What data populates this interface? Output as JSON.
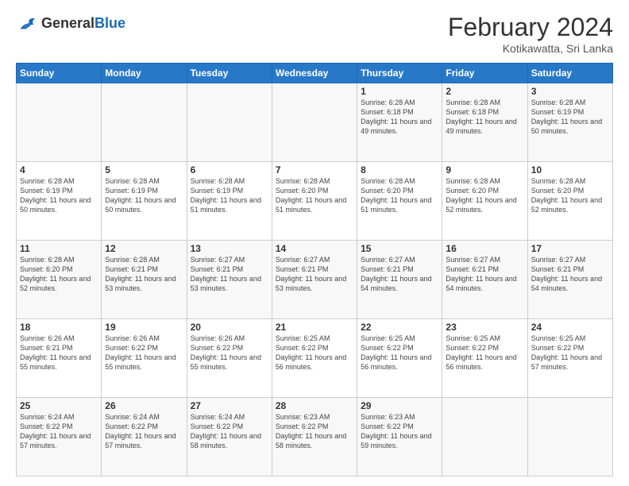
{
  "header": {
    "logo_general": "General",
    "logo_blue": "Blue",
    "title": "February 2024",
    "location": "Kotikawatta, Sri Lanka"
  },
  "weekdays": [
    "Sunday",
    "Monday",
    "Tuesday",
    "Wednesday",
    "Thursday",
    "Friday",
    "Saturday"
  ],
  "weeks": [
    [
      {
        "day": "",
        "info": ""
      },
      {
        "day": "",
        "info": ""
      },
      {
        "day": "",
        "info": ""
      },
      {
        "day": "",
        "info": ""
      },
      {
        "day": "1",
        "info": "Sunrise: 6:28 AM\nSunset: 6:18 PM\nDaylight: 11 hours and 49 minutes."
      },
      {
        "day": "2",
        "info": "Sunrise: 6:28 AM\nSunset: 6:18 PM\nDaylight: 11 hours and 49 minutes."
      },
      {
        "day": "3",
        "info": "Sunrise: 6:28 AM\nSunset: 6:19 PM\nDaylight: 11 hours and 50 minutes."
      }
    ],
    [
      {
        "day": "4",
        "info": "Sunrise: 6:28 AM\nSunset: 6:19 PM\nDaylight: 11 hours and 50 minutes."
      },
      {
        "day": "5",
        "info": "Sunrise: 6:28 AM\nSunset: 6:19 PM\nDaylight: 11 hours and 50 minutes."
      },
      {
        "day": "6",
        "info": "Sunrise: 6:28 AM\nSunset: 6:19 PM\nDaylight: 11 hours and 51 minutes."
      },
      {
        "day": "7",
        "info": "Sunrise: 6:28 AM\nSunset: 6:20 PM\nDaylight: 11 hours and 51 minutes."
      },
      {
        "day": "8",
        "info": "Sunrise: 6:28 AM\nSunset: 6:20 PM\nDaylight: 11 hours and 51 minutes."
      },
      {
        "day": "9",
        "info": "Sunrise: 6:28 AM\nSunset: 6:20 PM\nDaylight: 11 hours and 52 minutes."
      },
      {
        "day": "10",
        "info": "Sunrise: 6:28 AM\nSunset: 6:20 PM\nDaylight: 11 hours and 52 minutes."
      }
    ],
    [
      {
        "day": "11",
        "info": "Sunrise: 6:28 AM\nSunset: 6:20 PM\nDaylight: 11 hours and 52 minutes."
      },
      {
        "day": "12",
        "info": "Sunrise: 6:28 AM\nSunset: 6:21 PM\nDaylight: 11 hours and 53 minutes."
      },
      {
        "day": "13",
        "info": "Sunrise: 6:27 AM\nSunset: 6:21 PM\nDaylight: 11 hours and 53 minutes."
      },
      {
        "day": "14",
        "info": "Sunrise: 6:27 AM\nSunset: 6:21 PM\nDaylight: 11 hours and 53 minutes."
      },
      {
        "day": "15",
        "info": "Sunrise: 6:27 AM\nSunset: 6:21 PM\nDaylight: 11 hours and 54 minutes."
      },
      {
        "day": "16",
        "info": "Sunrise: 6:27 AM\nSunset: 6:21 PM\nDaylight: 11 hours and 54 minutes."
      },
      {
        "day": "17",
        "info": "Sunrise: 6:27 AM\nSunset: 6:21 PM\nDaylight: 11 hours and 54 minutes."
      }
    ],
    [
      {
        "day": "18",
        "info": "Sunrise: 6:26 AM\nSunset: 6:21 PM\nDaylight: 11 hours and 55 minutes."
      },
      {
        "day": "19",
        "info": "Sunrise: 6:26 AM\nSunset: 6:22 PM\nDaylight: 11 hours and 55 minutes."
      },
      {
        "day": "20",
        "info": "Sunrise: 6:26 AM\nSunset: 6:22 PM\nDaylight: 11 hours and 55 minutes."
      },
      {
        "day": "21",
        "info": "Sunrise: 6:25 AM\nSunset: 6:22 PM\nDaylight: 11 hours and 56 minutes."
      },
      {
        "day": "22",
        "info": "Sunrise: 6:25 AM\nSunset: 6:22 PM\nDaylight: 11 hours and 56 minutes."
      },
      {
        "day": "23",
        "info": "Sunrise: 6:25 AM\nSunset: 6:22 PM\nDaylight: 11 hours and 56 minutes."
      },
      {
        "day": "24",
        "info": "Sunrise: 6:25 AM\nSunset: 6:22 PM\nDaylight: 11 hours and 57 minutes."
      }
    ],
    [
      {
        "day": "25",
        "info": "Sunrise: 6:24 AM\nSunset: 6:22 PM\nDaylight: 11 hours and 57 minutes."
      },
      {
        "day": "26",
        "info": "Sunrise: 6:24 AM\nSunset: 6:22 PM\nDaylight: 11 hours and 57 minutes."
      },
      {
        "day": "27",
        "info": "Sunrise: 6:24 AM\nSunset: 6:22 PM\nDaylight: 11 hours and 58 minutes."
      },
      {
        "day": "28",
        "info": "Sunrise: 6:23 AM\nSunset: 6:22 PM\nDaylight: 11 hours and 58 minutes."
      },
      {
        "day": "29",
        "info": "Sunrise: 6:23 AM\nSunset: 6:22 PM\nDaylight: 11 hours and 59 minutes."
      },
      {
        "day": "",
        "info": ""
      },
      {
        "day": "",
        "info": ""
      }
    ]
  ]
}
